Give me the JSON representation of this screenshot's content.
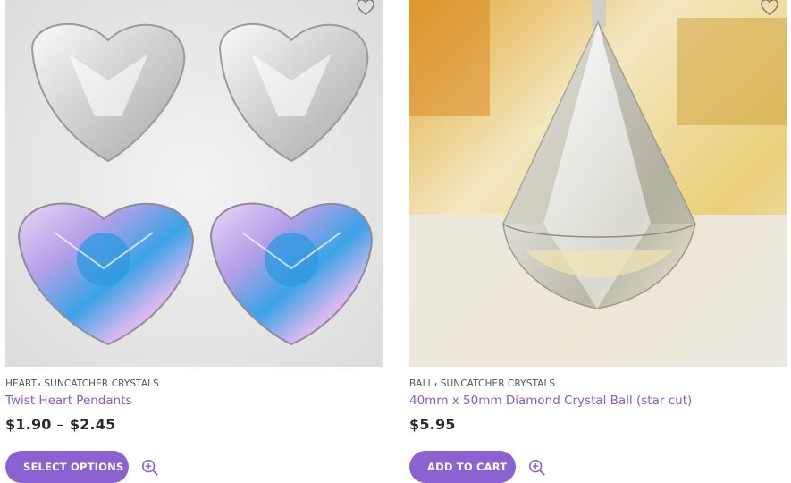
{
  "products": [
    {
      "categories": [
        "HEART",
        "SUNCATCHER CRYSTALS"
      ],
      "category_separator": ",",
      "title": "Twist Heart Pendants",
      "price_low": "$1.90",
      "price_sep": "–",
      "price_high": "$2.45",
      "button_label": "SELECT OPTIONS",
      "icons": [
        "heart-outline-icon",
        "zoom-in-icon"
      ]
    },
    {
      "categories": [
        "BALL",
        "SUNCATCHER CRYSTALS"
      ],
      "category_separator": ",",
      "title": "40mm x 50mm Diamond Crystal Ball (star cut)",
      "price": "$5.95",
      "button_label": "ADD TO CART",
      "icons": [
        "heart-outline-icon",
        "zoom-in-icon"
      ]
    }
  ],
  "colors": {
    "accent": "#8b62d1",
    "title": "#8a5cc8"
  }
}
